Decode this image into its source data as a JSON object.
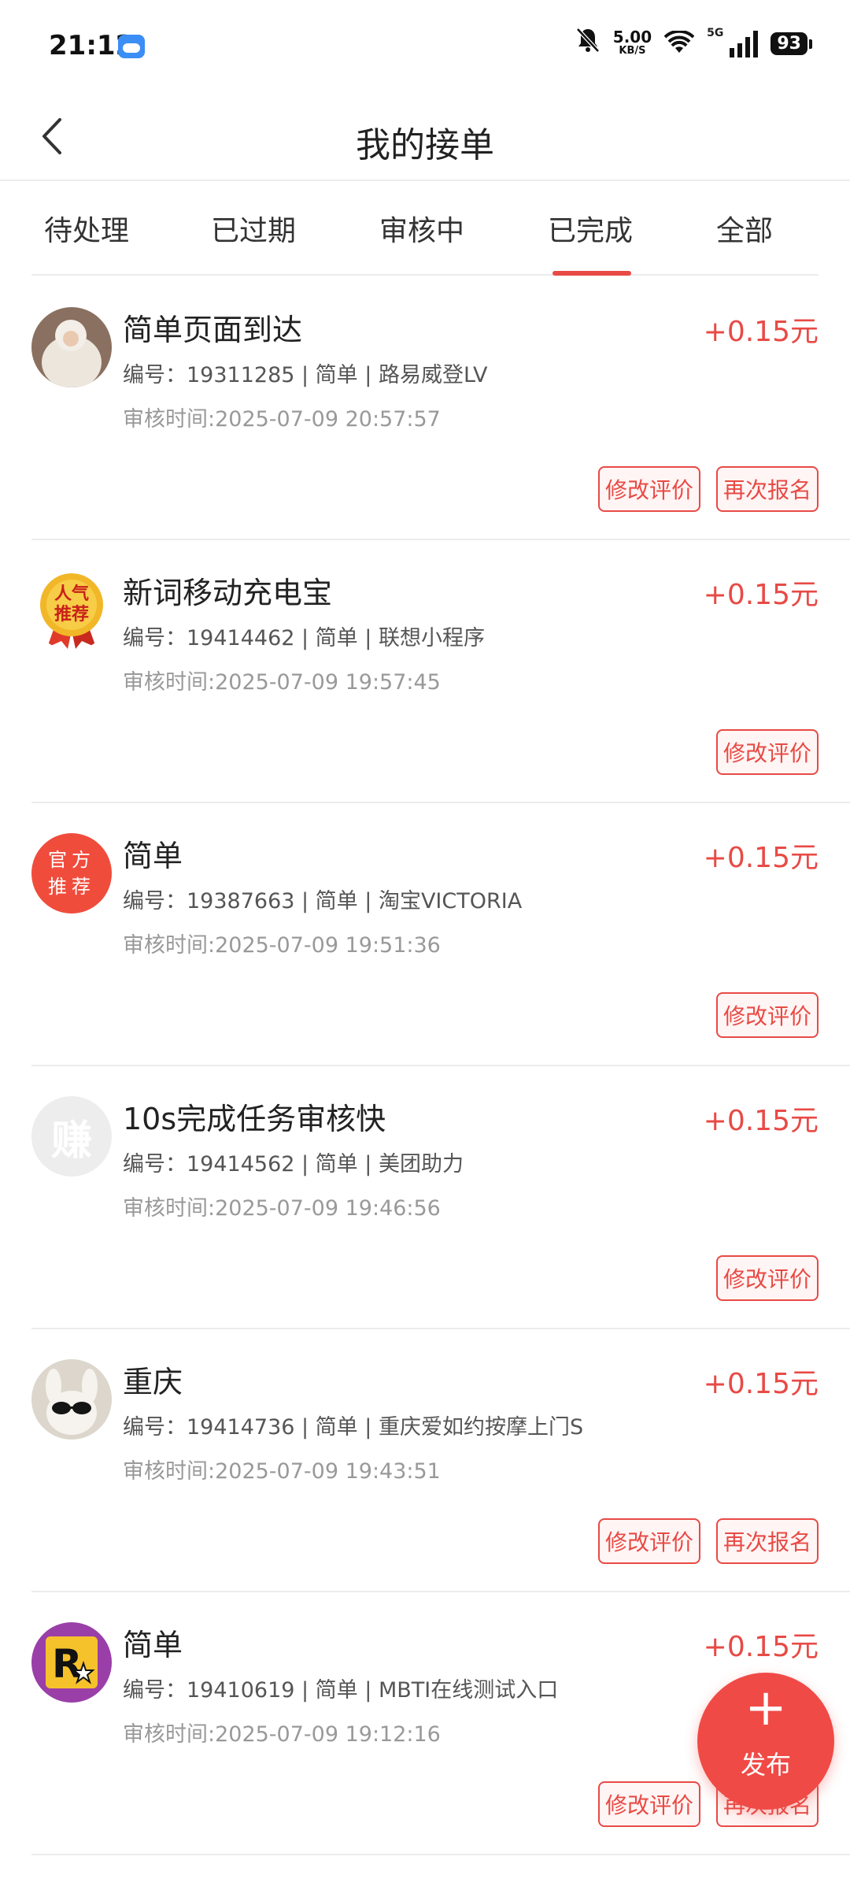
{
  "status_bar": {
    "time": "21:12",
    "net_speed": "5.00",
    "net_unit": "KB/S",
    "signal_type": "5G",
    "battery": "93"
  },
  "header": {
    "title": "我的接单"
  },
  "tabs": [
    {
      "label": "待处理"
    },
    {
      "label": "已过期"
    },
    {
      "label": "审核中"
    },
    {
      "label": "已完成",
      "active": true
    },
    {
      "label": "全部"
    }
  ],
  "orders": [
    {
      "title": "简单页面到达",
      "reward": "+0.15元",
      "meta": "编号：19311285 | 简单 | 路易威登LV",
      "time": "审核时间:2025-07-09 20:57:57",
      "avatar": "photo",
      "buttons": [
        "修改评价",
        "再次报名"
      ]
    },
    {
      "title": "新词移动充电宝",
      "reward": "+0.15元",
      "meta": "编号：19414462 | 简单 | 联想小程序",
      "time": "审核时间:2025-07-09 19:57:45",
      "avatar": "medal",
      "avatar_text": "人气推荐",
      "buttons": [
        "修改评价"
      ]
    },
    {
      "title": "简单",
      "reward": "+0.15元",
      "meta": "编号：19387663 | 简单 | 淘宝VICTORIA",
      "time": "审核时间:2025-07-09 19:51:36",
      "avatar": "official",
      "avatar_text": "官方推荐",
      "buttons": [
        "修改评价"
      ]
    },
    {
      "title": "10s完成任务审核快",
      "reward": "+0.15元",
      "meta": "编号：19414562 | 简单 | 美团助力",
      "time": "审核时间:2025-07-09 19:46:56",
      "avatar": "earn",
      "avatar_text": "赚",
      "buttons": [
        "修改评价"
      ]
    },
    {
      "title": "重庆",
      "reward": "+0.15元",
      "meta": "编号：19414736 | 简单 | 重庆爱如约按摩上门S",
      "time": "审核时间:2025-07-09 19:43:51",
      "avatar": "bunny",
      "buttons": [
        "修改评价",
        "再次报名"
      ]
    },
    {
      "title": "简单",
      "reward": "+0.15元",
      "meta": "编号：19410619 | 简单 | MBTI在线测试入口",
      "time": "审核时间:2025-07-09 19:12:16",
      "avatar": "r-logo",
      "buttons": [
        "修改评价",
        "再次报名"
      ]
    }
  ],
  "fab": {
    "icon": "+",
    "label": "发布"
  },
  "colors": {
    "accent": "#e84a45"
  }
}
